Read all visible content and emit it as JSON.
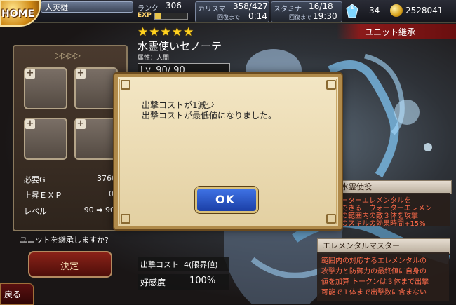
{
  "header": {
    "home_label": "HOME",
    "player_name": "大英雄",
    "rank_label": "ランク",
    "rank_value": "306",
    "exp_label": "EXP",
    "charisma_label": "カリスマ",
    "charisma_value": "358/427",
    "charisma_recovery_label": "回復まで",
    "charisma_recovery_time": "0:14",
    "stamina_label": "スタミナ",
    "stamina_value": "16/18",
    "stamina_recovery_label": "回復まで",
    "stamina_recovery_time": "19:30",
    "gem_count": "34",
    "gold_count": "2528041",
    "screen_title": "ユニット継承"
  },
  "inherit_panel": {
    "arrows": "▷▷▷▷",
    "required_gold_label": "必要G",
    "required_gold_value": "3760",
    "exp_up_label": "上昇ＥＸＰ",
    "exp_up_value": "0",
    "level_label": "レベル",
    "level_value": "90 ➡ 90",
    "confirm_text": "ユニットを継承しますか?",
    "decide_label": "決定",
    "back_label": "戻る"
  },
  "unit": {
    "stars": "★★★★★",
    "name": "水霊使いセノーテ",
    "attribute": "属性：人間",
    "level": "Lv. 90/  90",
    "cost_label": "出撃コスト",
    "cost_value": "4(限界値)",
    "affection_label": "好感度",
    "affection_value": "100%"
  },
  "skills": {
    "skill1_title": "水霊使役",
    "skill1_lines": [
      "ーターエレメンタルを",
      "できる　ウォーターエレメン",
      "の範囲内の敵３体を攻撃",
      "のスキルの効果時間+15%"
    ],
    "skill2_title": "エレメンタルマスター",
    "skill2_lines": [
      "範囲内の対応するエレメンタルの",
      "攻撃力と防御力の最終値に自身の",
      "値を加算 トークンは３体まで出撃",
      "可能で１体まで出撃数に含まない"
    ]
  },
  "dialog": {
    "message_line1": "出撃コストが1減少",
    "message_line2": "出撃コストが最低値になりました。",
    "ok_label": "OK"
  },
  "colors": {
    "ok_button": "#2b5ad1",
    "decide_button": "#6e1a12",
    "title_banner": "#8b1a1a",
    "star": "#ffd21f",
    "dialog_bg": "#efe0b8"
  }
}
